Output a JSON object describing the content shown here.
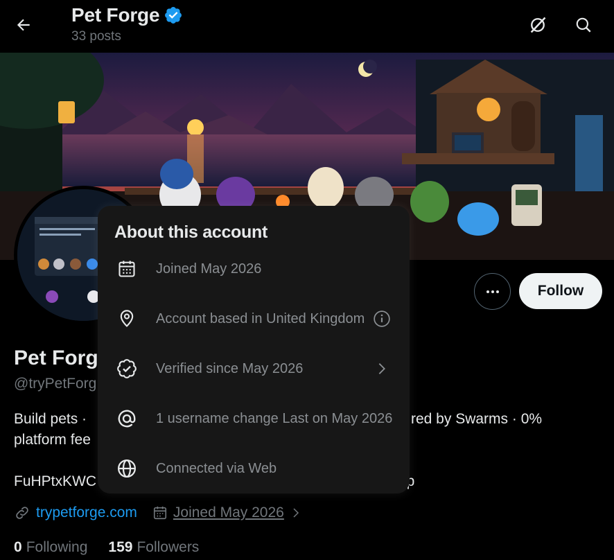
{
  "header": {
    "title": "Pet Forge",
    "posts": "33 posts"
  },
  "profile": {
    "name": "Pet Forg",
    "handle": "@tryPetForg",
    "bio_line1": "Build pets ·",
    "bio_line1_right": "red by Swarms · 0%",
    "bio_line2": "platform fee",
    "bio_line3": "FuHPtxKWC",
    "bio_line3_right": "np",
    "website": "trypetforge.com",
    "joined": "Joined May 2026",
    "following_count": "0",
    "following_label": "Following",
    "followers_count": "159",
    "followers_label": "Followers",
    "follow_button": "Follow"
  },
  "about": {
    "title": "About this account",
    "items": [
      {
        "text": "Joined May 2026",
        "icon": "calendar-icon"
      },
      {
        "text": "Account based in United Kingdom",
        "icon": "location-pin-icon"
      },
      {
        "text": "Verified since May 2026",
        "icon": "verified-badge-icon"
      },
      {
        "text": "1 username change Last on May 2026",
        "icon": "at-sign-icon"
      },
      {
        "text": "Connected via Web",
        "icon": "globe-icon"
      }
    ]
  },
  "colors": {
    "accent": "#1d9bf0",
    "background": "#000000",
    "popover": "#171717",
    "muted": "#71767b"
  }
}
